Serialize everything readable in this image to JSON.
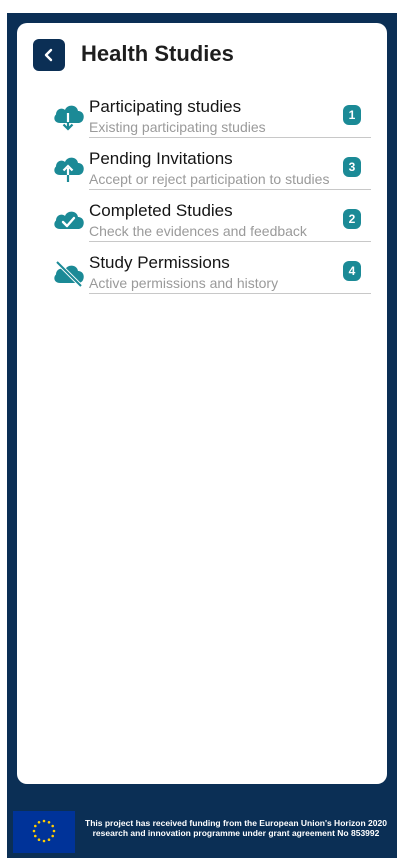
{
  "header": {
    "title": "Health Studies",
    "back_icon": "chevron-left-icon"
  },
  "colors": {
    "frame": "#0b2f55",
    "accent": "#1b8a96",
    "card": "#ffffff"
  },
  "items": [
    {
      "title": "Participating studies",
      "subtitle": "Existing participating studies",
      "badge": "1",
      "icon": "cloud-download-icon"
    },
    {
      "title": "Pending Invitations",
      "subtitle": "Accept or reject participation to studies",
      "badge": "3",
      "icon": "cloud-upload-icon"
    },
    {
      "title": "Completed Studies",
      "subtitle": "Check the evidences and feedback",
      "badge": "2",
      "icon": "cloud-check-icon"
    },
    {
      "title": "Study Permissions",
      "subtitle": "Active permissions and history",
      "badge": "4",
      "icon": "cloud-off-icon"
    }
  ],
  "footer": {
    "text": "This project has received funding from the European Union's Horizon 2020 research and innovation programme under grant agreement No 853992",
    "logo": "eu-flag-icon"
  }
}
